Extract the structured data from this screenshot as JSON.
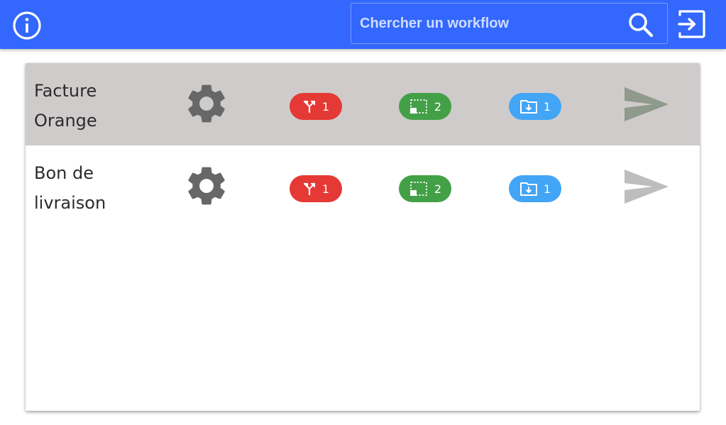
{
  "colors": {
    "topbar": "#3367fd",
    "selected_row": "#cfcbcb",
    "chip_red": "#e53935",
    "chip_green": "#43a047",
    "chip_blue": "#42a5f5",
    "send_active": "#8f9a8c",
    "send_inactive": "#bdbdbd"
  },
  "header": {
    "info_icon": "info-circle-icon",
    "search": {
      "placeholder": "Chercher un workflow",
      "value": "",
      "icon": "search-icon"
    },
    "logout_icon": "logout-icon"
  },
  "workflows": [
    {
      "name": "Facture Orange",
      "selected": true,
      "settings_icon": "gear-icon",
      "branches": "1",
      "zones": "2",
      "imports": "1",
      "send_icon": "send-icon"
    },
    {
      "name": "Bon de livraison",
      "selected": false,
      "settings_icon": "gear-icon",
      "branches": "1",
      "zones": "2",
      "imports": "1",
      "send_icon": "send-icon"
    }
  ]
}
